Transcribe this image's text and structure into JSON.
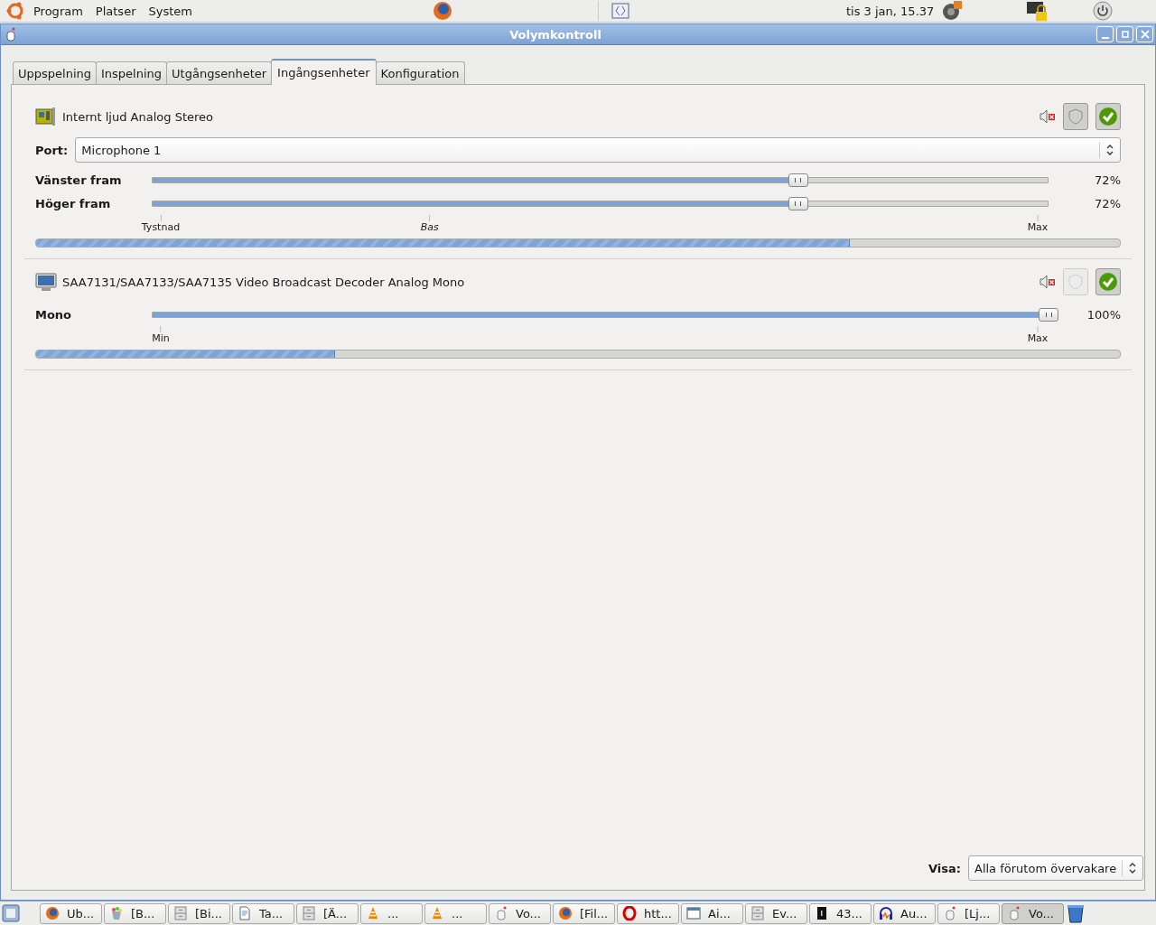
{
  "top_panel": {
    "menus": [
      "Program",
      "Platser",
      "System"
    ],
    "clock": "tis  3 jan, 15.37"
  },
  "window": {
    "title": "Volymkontroll"
  },
  "tabs": [
    {
      "label": "Uppspelning",
      "selected": false
    },
    {
      "label": "Inspelning",
      "selected": false
    },
    {
      "label": "Utgångsenheter",
      "selected": false
    },
    {
      "label": "Ingångsenheter",
      "selected": true
    },
    {
      "label": "Konfiguration",
      "selected": false
    }
  ],
  "devices": [
    {
      "kind": "soundcard",
      "name": "Internt ljud Analog Stereo",
      "lock_enabled": true,
      "is_default": true,
      "port": {
        "label": "Port:",
        "value": "Microphone 1"
      },
      "channels": [
        {
          "name": "Vänster fram",
          "level": 0.72,
          "reading": "72%"
        },
        {
          "name": "Höger fram",
          "level": 0.72,
          "reading": "72%"
        }
      ],
      "ticks": [
        {
          "label": "Tystnad",
          "kind": "start"
        },
        {
          "label": "Bas",
          "kind": "base",
          "level": 0.31
        },
        {
          "label": "Max",
          "kind": "end"
        }
      ],
      "peak": {
        "level": 0.75
      }
    },
    {
      "kind": "monitor",
      "name": "SAA7131/SAA7133/SAA7135 Video Broadcast Decoder Analog Mono",
      "lock_enabled": false,
      "is_default": true,
      "channels": [
        {
          "name": "Mono",
          "level": 1.0,
          "reading": "100%"
        }
      ],
      "ticks": [
        {
          "label": "Min",
          "kind": "start"
        },
        {
          "label": "Max",
          "kind": "end"
        }
      ],
      "peak": {
        "level": 0.275
      }
    }
  ],
  "view_filter": {
    "label": "Visa:",
    "value": "Alla förutom övervakare"
  },
  "taskbar": [
    {
      "kind": "browser",
      "label": "Ub...",
      "selected": false
    },
    {
      "kind": "paint",
      "label": "[B...",
      "selected": false
    },
    {
      "kind": "cabinet",
      "label": "[Bi...",
      "selected": false
    },
    {
      "kind": "document",
      "label": "Ta...",
      "selected": false
    },
    {
      "kind": "cabinet",
      "label": "[Ä...",
      "selected": false
    },
    {
      "kind": "cone",
      "label": "...",
      "selected": false
    },
    {
      "kind": "cone",
      "label": "...",
      "selected": false
    },
    {
      "kind": "mixer",
      "label": "Vo...",
      "selected": false
    },
    {
      "kind": "browser",
      "label": "[Fil...",
      "selected": false
    },
    {
      "kind": "letter",
      "label": "htt...",
      "selected": false
    },
    {
      "kind": "window",
      "label": "Ai...",
      "selected": false
    },
    {
      "kind": "cabinet",
      "label": "Ev...",
      "selected": false
    },
    {
      "kind": "terminal",
      "label": "43...",
      "selected": false
    },
    {
      "kind": "headphones",
      "label": "Au...",
      "selected": false
    },
    {
      "kind": "mixer",
      "label": "[Lj...",
      "selected": false
    },
    {
      "kind": "mixer",
      "label": "Vo...",
      "selected": true
    }
  ]
}
